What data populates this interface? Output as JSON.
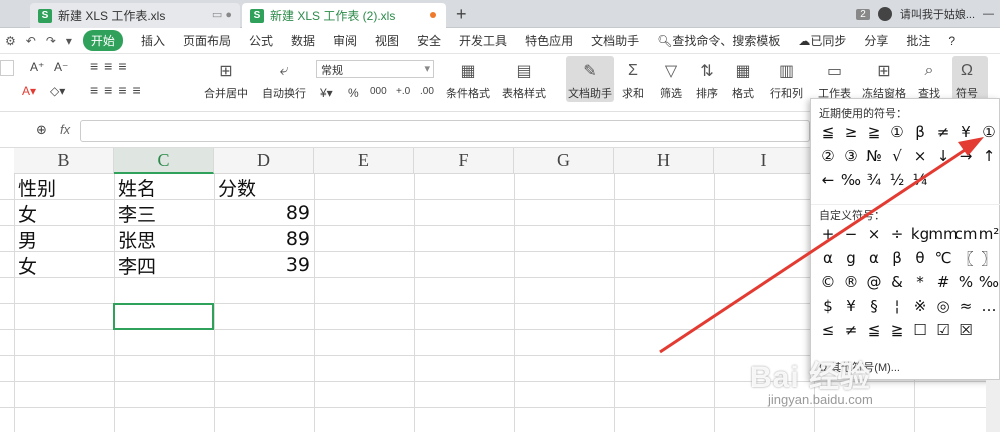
{
  "tabs": [
    {
      "label": "新建 XLS 工作表.xls",
      "badge": "S"
    },
    {
      "label": "新建 XLS 工作表 (2).xls",
      "badge": "S"
    }
  ],
  "topright": {
    "count": "2",
    "user": "请叫我于姑娘..."
  },
  "menu": {
    "start": "开始",
    "items": [
      "插入",
      "页面布局",
      "公式",
      "数据",
      "审阅",
      "视图",
      "安全",
      "开发工具",
      "特色应用",
      "文档助手"
    ],
    "search": "查找命令、搜索模板",
    "sync": "已同步",
    "share": "分享",
    "comment": "批注",
    "help": "?"
  },
  "ribbon": {
    "merge": "合并居中",
    "wrap": "自动换行",
    "numformat": "常规",
    "condfmt": "条件格式",
    "tablestyle": "表格样式",
    "dochelper": "文档助手",
    "sum": "求和",
    "filter": "筛选",
    "sort": "排序",
    "format": "格式",
    "rowcol": "行和列",
    "sheet": "工作表",
    "freeze": "冻结窗格",
    "find": "查找",
    "symbol": "符号",
    "font_a1": "A⁺",
    "font_a2": "A⁻",
    "percent": "%",
    "thousands": "000",
    "inc": "+.0",
    "dec": ".00"
  },
  "formula": {
    "fx": "fx"
  },
  "columns": [
    "B",
    "C",
    "D",
    "E",
    "F",
    "G",
    "H",
    "I"
  ],
  "rows": [
    {
      "b": "性别",
      "c": "姓名",
      "d": "分数"
    },
    {
      "b": "女",
      "c": "李三",
      "d": "89"
    },
    {
      "b": "男",
      "c": "张思",
      "d": "89"
    },
    {
      "b": "女",
      "c": "李四",
      "d": "39"
    }
  ],
  "panel": {
    "recent_title": "近期使用的符号：",
    "recent": [
      "≦",
      "≥",
      "≧",
      "①",
      "β",
      "≠",
      "¥",
      "①",
      "②",
      "③",
      "№",
      "√",
      "×",
      "↓",
      "→",
      "↑",
      "←",
      "‰",
      "¾",
      "½",
      "¼"
    ],
    "custom_title": "自定义符号：",
    "custom": [
      "+",
      "−",
      "×",
      "÷",
      "kg",
      "mm",
      "cm",
      "m²",
      "α",
      "g",
      "α",
      "β",
      "θ",
      "℃",
      "〖",
      "〗",
      "©",
      "®",
      "@",
      "&",
      "*",
      "#",
      "%",
      "‰",
      "$",
      "¥",
      "§",
      "¦",
      "※",
      "◎",
      "≈",
      "…",
      "≤",
      "≠",
      "≦",
      "≧",
      "☐",
      "☑",
      "☒",
      ""
    ],
    "more": "其他符号(M)..."
  },
  "watermark": {
    "brand": "Bai 经验",
    "url": "jingyan.baidu.com"
  },
  "colors": {
    "accent": "#2fa15a",
    "arrow": "#e33b32"
  }
}
